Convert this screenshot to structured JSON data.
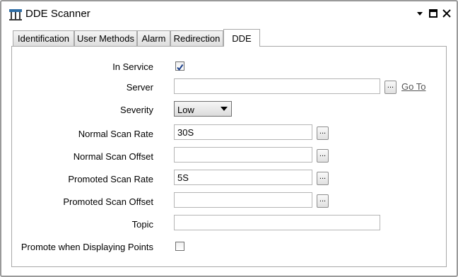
{
  "window": {
    "title": "DDE Scanner"
  },
  "tabs": [
    {
      "label": "Identification"
    },
    {
      "label": "User Methods"
    },
    {
      "label": "Alarm"
    },
    {
      "label": "Redirection"
    },
    {
      "label": "DDE"
    }
  ],
  "active_tab": "DDE",
  "form": {
    "in_service": {
      "label": "In Service",
      "checked": true
    },
    "server": {
      "label": "Server",
      "value": "",
      "browse": "...",
      "goto": "Go To"
    },
    "severity": {
      "label": "Severity",
      "value": "Low"
    },
    "normal_scan_rate": {
      "label": "Normal Scan Rate",
      "value": "30S",
      "browse": "..."
    },
    "normal_scan_offset": {
      "label": "Normal Scan Offset",
      "value": "",
      "browse": "..."
    },
    "promoted_scan_rate": {
      "label": "Promoted Scan Rate",
      "value": "5S",
      "browse": "..."
    },
    "promoted_scan_offset": {
      "label": "Promoted Scan Offset",
      "value": "",
      "browse": "..."
    },
    "topic": {
      "label": "Topic",
      "value": ""
    },
    "promote_when_displaying": {
      "label": "Promote when Displaying Points",
      "checked": false
    }
  },
  "icons": {
    "app": "dde-scanner-icon",
    "pin": "pin-icon",
    "maximize": "maximize-icon",
    "close": "close-icon",
    "dropdown": "chevron-down-icon",
    "check": "checkmark-icon"
  }
}
